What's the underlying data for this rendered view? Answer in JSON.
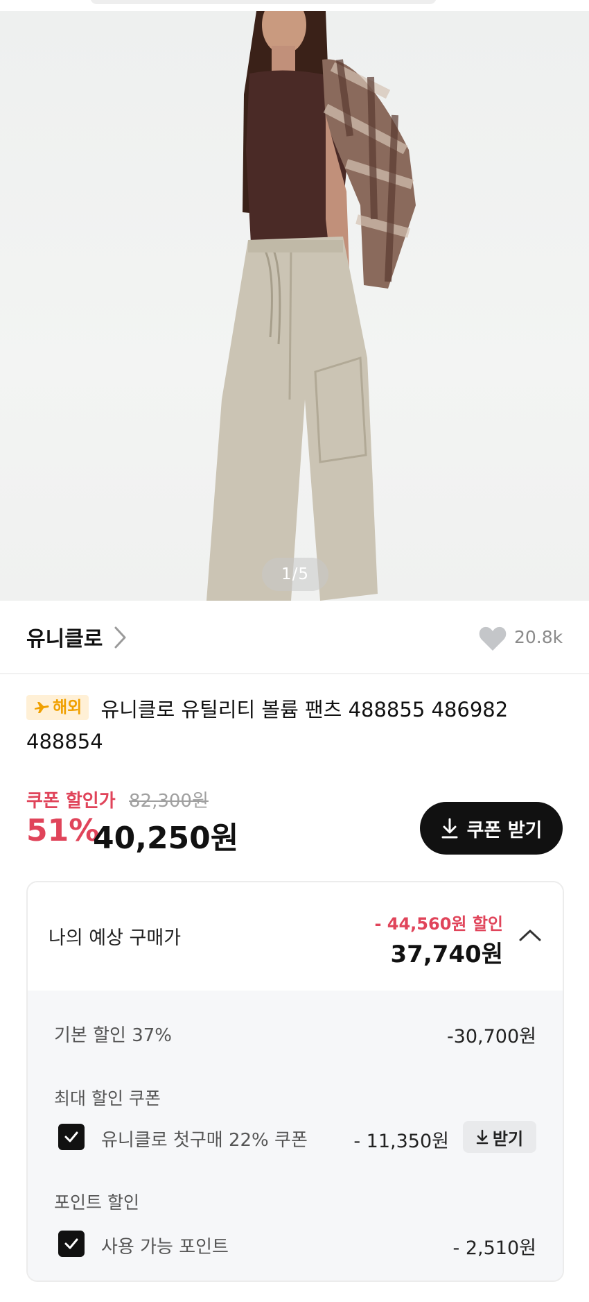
{
  "gallery": {
    "pager": "1/5",
    "colors": {
      "top": "#4a2a26",
      "pants": "#cbc4b4",
      "background": "#eff0ef"
    }
  },
  "brand": {
    "name": "유니클로",
    "likes": "20.8k"
  },
  "product": {
    "badge": "해외",
    "title": "유니클로 유틸리티 볼륨 팬츠 488855 486982 488854"
  },
  "price": {
    "coupon_label": "쿠폰 할인가",
    "original": "82,300원",
    "discount_percent": "51%",
    "sale": "40,250원",
    "coupon_button": "쿠폰 받기"
  },
  "estimate": {
    "label": "나의 예상 구매가",
    "discount": "- 44,560원 할인",
    "price": "37,740원",
    "base_discount_label": "기본 할인 37%",
    "base_discount_amount": "-30,700원",
    "max_coupon_section": "최대 할인 쿠폰",
    "coupon_item_label": "유니클로 첫구매 22% 쿠폰",
    "coupon_item_amount": "- 11,350원",
    "coupon_receive": "받기",
    "point_section": "포인트 할인",
    "point_item_label": "사용 가능 포인트",
    "point_item_amount": "- 2,510원"
  },
  "accent_colors": {
    "sale_red": "#e0445a",
    "button_black": "#111111",
    "badge_orange": "#f0a000"
  }
}
